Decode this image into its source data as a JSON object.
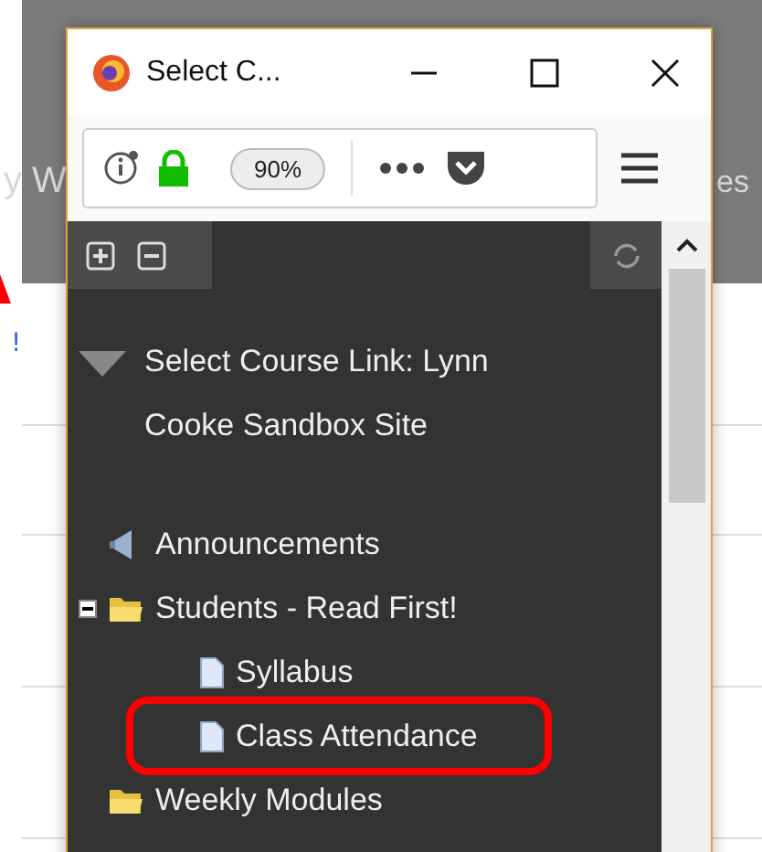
{
  "background": {
    "header_left": "y W",
    "header_right": "es",
    "link": "!"
  },
  "window": {
    "title": "Select C...",
    "zoom": "90%"
  },
  "tree": {
    "root": {
      "label": "Select Course Link: Lynn Cooke Sandbox Site",
      "expanded": true
    },
    "items": [
      {
        "label": "Announcements",
        "kind": "announcement",
        "expanded": false,
        "highlighted": false
      },
      {
        "label": "Students - Read First!",
        "kind": "folder",
        "expanded": true,
        "highlighted": false,
        "children": [
          {
            "label": "Syllabus",
            "kind": "page",
            "highlighted": false
          },
          {
            "label": "Class Attendance",
            "kind": "page",
            "highlighted": true
          }
        ]
      },
      {
        "label": "Weekly Modules",
        "kind": "folder",
        "expanded": false,
        "highlighted": false
      }
    ]
  }
}
